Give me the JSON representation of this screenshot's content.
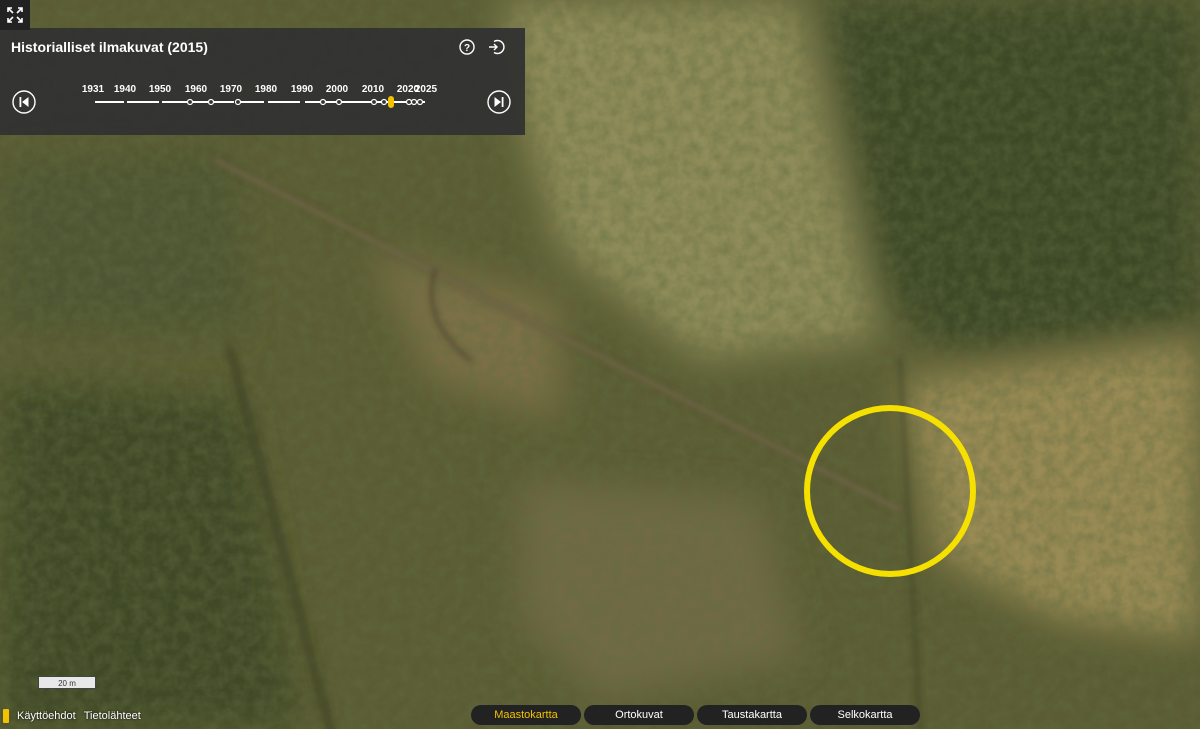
{
  "panel": {
    "title": "Historialliset ilmakuvat (2015)",
    "help_icon": "question-circle-icon",
    "exit_icon": "exit-icon",
    "prev_icon": "skip-previous-icon",
    "next_icon": "skip-next-icon",
    "year_labels": [
      "1931",
      "1940",
      "1950",
      "1960",
      "1970",
      "1980",
      "1990",
      "2000",
      "2010",
      "2020",
      "2025"
    ],
    "selected_year": "2015",
    "accent_color": "#f2c200"
  },
  "map": {
    "marker_color": "#f5e000",
    "marker_shape": "circle"
  },
  "scale": {
    "label": "20 m"
  },
  "footer": {
    "terms": "Käyttöehdot",
    "sources": "Tietolähteet"
  },
  "map_tabs": [
    {
      "label": "Maastokartta",
      "active": true
    },
    {
      "label": "Ortokuvat",
      "active": false
    },
    {
      "label": "Taustakartta",
      "active": false
    },
    {
      "label": "Selkokartta",
      "active": false
    }
  ]
}
